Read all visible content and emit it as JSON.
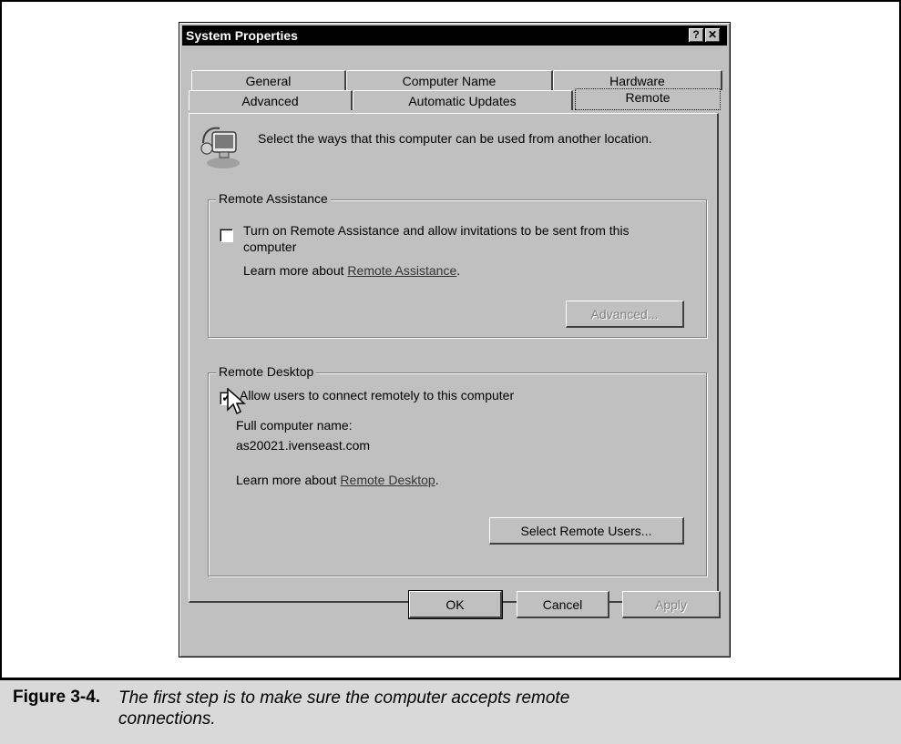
{
  "dialog": {
    "title": "System Properties",
    "help_button": "?",
    "close_button": "✕"
  },
  "tabs": {
    "row1": [
      "General",
      "Computer Name",
      "Hardware"
    ],
    "row2": [
      "Advanced",
      "Automatic Updates",
      "Remote"
    ],
    "active": "Remote"
  },
  "intro": {
    "icon": "computer-network-icon",
    "text": "Select the ways that this computer can be used from another location."
  },
  "remote_assistance": {
    "group_title": "Remote Assistance",
    "checkbox_label": "Turn on Remote Assistance and allow invitations to be sent from this",
    "checkbox_label_line2": "computer",
    "checked": false,
    "learn_more_prefix": "Learn more about",
    "learn_more_link": "Remote Assistance",
    "learn_more_suffix": ".",
    "advanced_button": "Advanced..."
  },
  "remote_desktop": {
    "group_title": "Remote Desktop",
    "checkbox_label": "Allow users to connect remotely to this computer",
    "checked": true,
    "full_name_label": "Full computer name:",
    "full_name_value": "as20021.ivenseast.com",
    "learn_more_prefix": "Learn more about",
    "learn_more_link": "Remote Desktop",
    "learn_more_suffix": ".",
    "select_users_button": "Select Remote Users..."
  },
  "footer_buttons": {
    "ok": "OK",
    "cancel": "Cancel",
    "apply": "Apply"
  },
  "caption": {
    "label": "Figure 3-4.",
    "text": "The first step is to make sure the computer accepts remote connections."
  }
}
